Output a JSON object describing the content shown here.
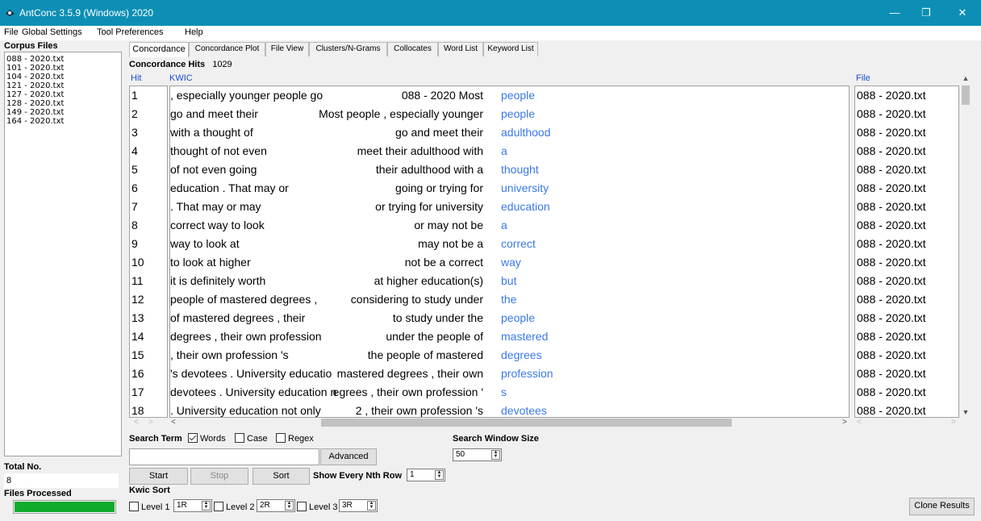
{
  "window": {
    "title": "AntConc 3.5.9 (Windows) 2020"
  },
  "window_controls": {
    "minimize": "—",
    "restore": "❐",
    "close": "✕"
  },
  "menu": [
    "File",
    "Global Settings",
    "Tool Preferences",
    "Help"
  ],
  "sidebar": {
    "corpus_title": "Corpus Files",
    "files": [
      "088 - 2020.txt",
      "101 - 2020.txt",
      "104 - 2020.txt",
      "121 - 2020.txt",
      "127 - 2020.txt",
      "128 - 2020.txt",
      "149 - 2020.txt",
      "164 - 2020.txt"
    ],
    "total_label": "Total No.",
    "total_value": "8",
    "processed_label": "Files Processed",
    "processed_fraction": 1.0
  },
  "tabs": [
    "Concordance",
    "Concordance Plot",
    "File View",
    "Clusters/N-Grams",
    "Collocates",
    "Word List",
    "Keyword List"
  ],
  "concordance": {
    "hits_label": "Concordance Hits",
    "hits_value": "1029",
    "col_hit": "Hit",
    "col_kwic": "KWIC",
    "col_file": "File",
    "rows": [
      {
        "hit": "1",
        "left": "088 - 2020 Most",
        "key": "people",
        "right": ", especially younger people go",
        "file": "088 - 2020.txt"
      },
      {
        "hit": "2",
        "left": "Most people , especially younger",
        "key": "people",
        "right": "go and  meet their",
        "file": "088 - 2020.txt"
      },
      {
        "hit": "3",
        "left": "go and  meet their",
        "key": "adulthood",
        "right": "with a thought of",
        "file": "088 - 2020.txt"
      },
      {
        "hit": "4",
        "left": "meet their adulthood with",
        "key": "a",
        "right": "thought of not  even",
        "file": "088 - 2020.txt"
      },
      {
        "hit": "5",
        "left": "their adulthood with a",
        "key": "thought",
        "right": "of not  even going",
        "file": "088 - 2020.txt"
      },
      {
        "hit": "6",
        "left": "going or trying for",
        "key": "university",
        "right": "education .  That may or",
        "file": "088 - 2020.txt"
      },
      {
        "hit": "7",
        "left": "or trying for university",
        "key": "education",
        "right": ".  That may or may",
        "file": "088 - 2020.txt"
      },
      {
        "hit": "8",
        "left": "or may not be",
        "key": "a",
        "right": "correct way to  look",
        "file": "088 - 2020.txt"
      },
      {
        "hit": "9",
        "left": "may not be a",
        "key": "correct",
        "right": "way to  look at",
        "file": "088 - 2020.txt"
      },
      {
        "hit": "10",
        "left": "not be a correct",
        "key": "way",
        "right": "to  look at higher",
        "file": "088 - 2020.txt"
      },
      {
        "hit": "11",
        "left": "at higher education(s)",
        "key": "but",
        "right": "it is definitely  worth",
        "file": "088 - 2020.txt"
      },
      {
        "hit": "12",
        "left": "considering to study under",
        "key": "the",
        "right": "people of  mastered degrees ,",
        "file": "088 - 2020.txt"
      },
      {
        "hit": "13",
        "left": "to study under the",
        "key": "people",
        "right": "of  mastered degrees , their",
        "file": "088 - 2020.txt"
      },
      {
        "hit": "14",
        "left": "under the people of",
        "key": "mastered",
        "right": "degrees , their own profession",
        "file": "088 - 2020.txt"
      },
      {
        "hit": "15",
        "left": "the people of  mastered",
        "key": "degrees",
        "right": ", their own profession 's",
        "file": "088 - 2020.txt"
      },
      {
        "hit": "16",
        "left": "mastered degrees , their own",
        "key": "profession",
        "right": "'s  devotees .  University educatio",
        "file": "088 - 2020.txt"
      },
      {
        "hit": "17",
        "left": "egrees , their own profession '",
        "key": "s",
        "right": "devotees .  University education n",
        "file": "088 - 2020.txt"
      },
      {
        "hit": "18",
        "left": "2 , their own profession 's",
        "key": "devotees",
        "right": ".  University education not only",
        "file": "088 - 2020.txt"
      }
    ]
  },
  "search": {
    "term_label": "Search Term",
    "opt_words": "Words",
    "opt_words_checked": true,
    "opt_case": "Case",
    "opt_case_checked": false,
    "opt_regex": "Regex",
    "opt_regex_checked": false,
    "input_value": "",
    "advanced": "Advanced",
    "window_size_label": "Search Window Size",
    "window_size_value": "50"
  },
  "controls": {
    "start": "Start",
    "stop": "Stop",
    "sort": "Sort",
    "nth_label": "Show Every Nth Row",
    "nth_value": "1",
    "clone": "Clone Results"
  },
  "kwic_sort": {
    "label": "Kwic Sort",
    "levels": [
      {
        "label": "Level 1",
        "value": "1R"
      },
      {
        "label": "Level 2",
        "value": "2R"
      },
      {
        "label": "Level 3",
        "value": "3R"
      }
    ]
  }
}
